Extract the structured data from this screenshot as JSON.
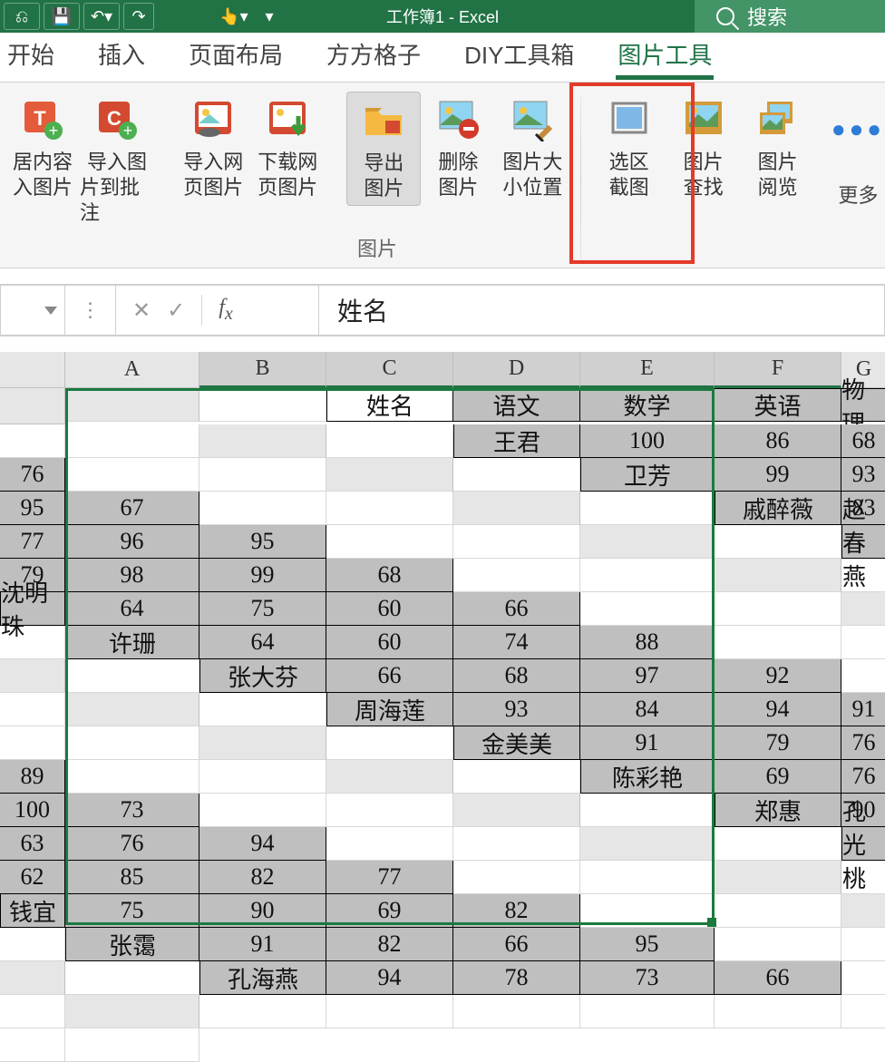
{
  "title": {
    "workbook": "工作簿1",
    "sep": " - ",
    "app": "Excel"
  },
  "search": {
    "label": "搜索"
  },
  "tabs": {
    "start": "开始",
    "insert": "插入",
    "layout": "页面布局",
    "grid": "方方格子",
    "diy": "DIY工具箱",
    "pic": "图片工具"
  },
  "ribbon": {
    "btn_insert_content_pic": {
      "l1": "居内容",
      "l2": "入图片"
    },
    "btn_import_to_note": {
      "l1": "导入图",
      "l2": "片到批注"
    },
    "btn_import_web": {
      "l1": "导入网",
      "l2": "页图片"
    },
    "btn_download_web": {
      "l1": "下载网",
      "l2": "页图片"
    },
    "btn_export_pic": {
      "l1": "导出",
      "l2": "图片"
    },
    "btn_delete_pic": {
      "l1": "删除",
      "l2": "图片"
    },
    "btn_pic_size_pos": {
      "l1": "图片大",
      "l2": "小位置"
    },
    "btn_selection_shot": {
      "l1": "选区",
      "l2": "截图"
    },
    "btn_pic_find": {
      "l1": "图片",
      "l2": "查找"
    },
    "btn_pic_view": {
      "l1": "图片",
      "l2": "阅览"
    },
    "btn_more": "更多",
    "group_label": "图片"
  },
  "formula_bar": {
    "value": "姓名"
  },
  "columns": [
    "A",
    "B",
    "C",
    "D",
    "E",
    "F",
    "G"
  ],
  "table": {
    "headers": [
      "姓名",
      "语文",
      "数学",
      "英语",
      "物理"
    ],
    "rows": [
      [
        "王君",
        "100",
        "86",
        "68",
        "76"
      ],
      [
        "卫芳",
        "99",
        "93",
        "95",
        "67"
      ],
      [
        "戚醉薇",
        "83",
        "77",
        "96",
        "95"
      ],
      [
        "赵春燕",
        "79",
        "98",
        "99",
        "68"
      ],
      [
        "沈明珠",
        "64",
        "75",
        "60",
        "66"
      ],
      [
        "许珊",
        "64",
        "60",
        "74",
        "88"
      ],
      [
        "张大芬",
        "66",
        "68",
        "97",
        "92"
      ],
      [
        "周海莲",
        "93",
        "84",
        "94",
        "91"
      ],
      [
        "金美美",
        "91",
        "79",
        "76",
        "89"
      ],
      [
        "陈彩艳",
        "69",
        "76",
        "100",
        "73"
      ],
      [
        "郑惠",
        "90",
        "63",
        "76",
        "94"
      ],
      [
        "孔光桃",
        "62",
        "85",
        "82",
        "77"
      ],
      [
        "钱宜",
        "75",
        "90",
        "69",
        "82"
      ],
      [
        "张霭",
        "91",
        "82",
        "66",
        "95"
      ],
      [
        "孔海燕",
        "94",
        "78",
        "73",
        "66"
      ]
    ]
  }
}
